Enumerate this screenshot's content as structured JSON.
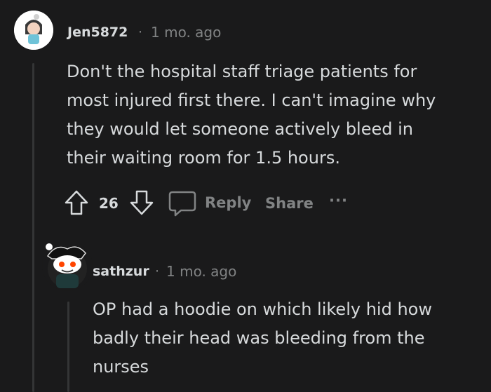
{
  "comments": [
    {
      "username": "Jen5872",
      "separator": "·",
      "time": "1 mo. ago",
      "body": "Don't the hospital staff triage patients for\nmost injured first there. I can't imagine why\nthey would let someone actively bleed in\ntheir waiting room for 1.5 hours.",
      "votes": "26",
      "reply_label": "Reply",
      "share_label": "Share",
      "more_label": "···"
    },
    {
      "username": "sathzur",
      "separator": "·",
      "time": "1 mo. ago",
      "body": "OP had a hoodie on which likely hid how\nbadly their head was bleeding from the\nnurses"
    }
  ]
}
